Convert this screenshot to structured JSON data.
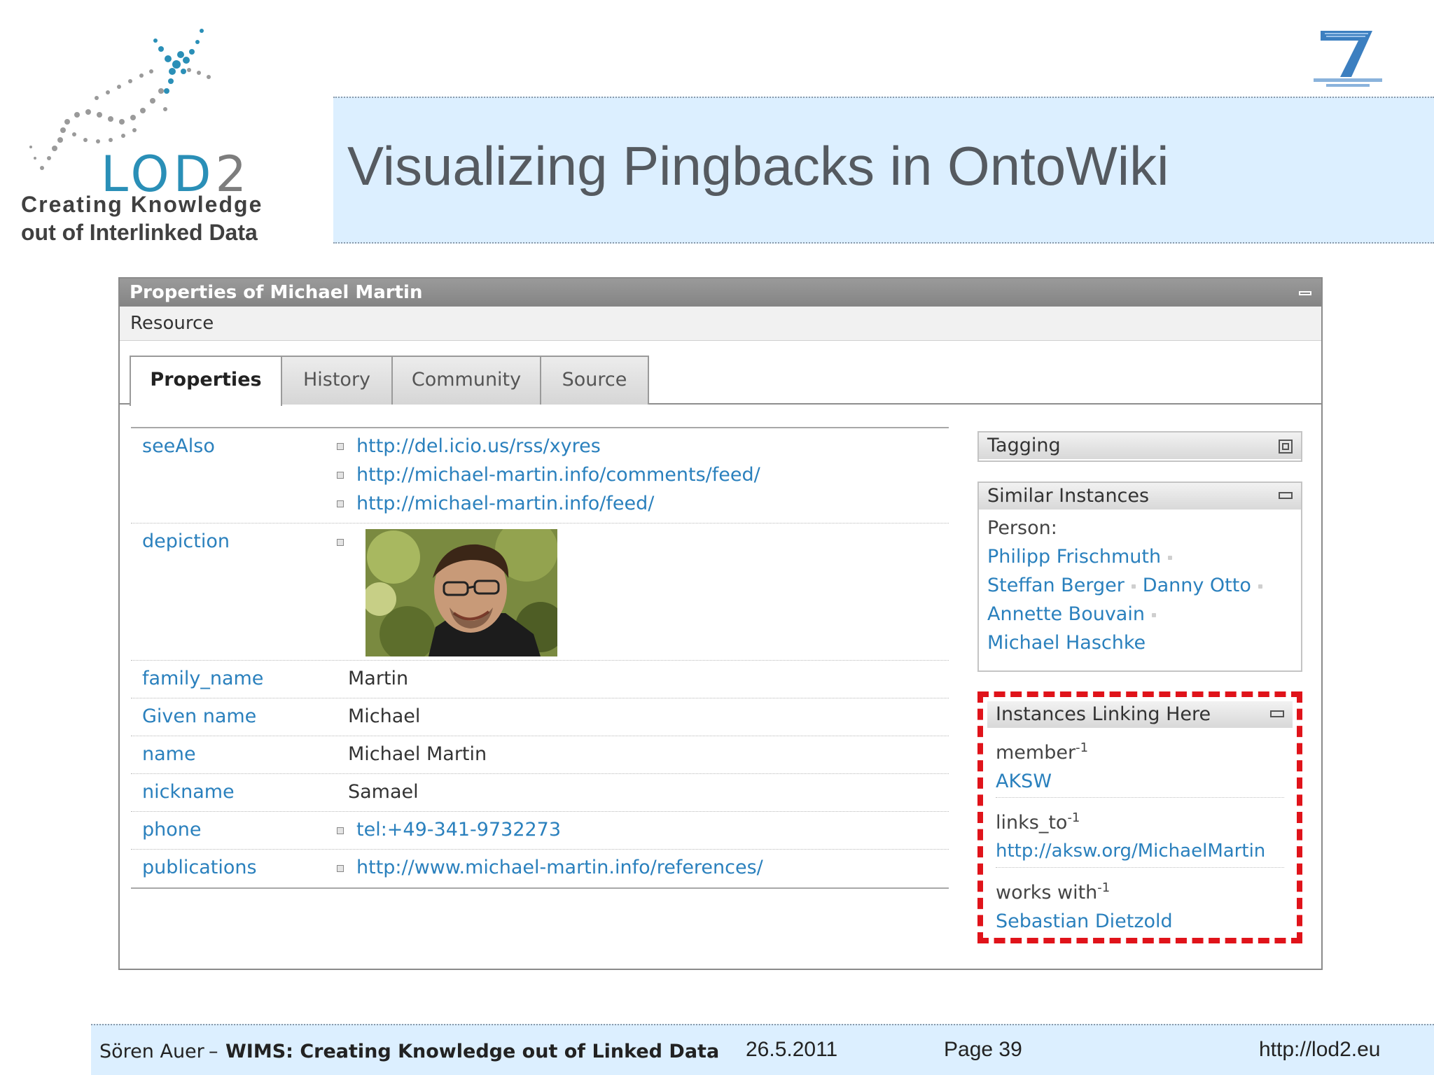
{
  "logo": {
    "word_main": "LOD",
    "word_num": "2",
    "tagline_1": "Creating Knowledge",
    "tagline_2": "out of Interlinked Data"
  },
  "slide": {
    "title": "Visualizing Pingbacks in OntoWiki"
  },
  "panel": {
    "title": "Properties of Michael Martin",
    "resource_label": "Resource",
    "tabs": [
      "Properties",
      "History",
      "Community",
      "Source"
    ],
    "active_tab": "Properties",
    "properties": {
      "seeAlso": {
        "key": "seeAlso",
        "values": [
          "http://del.icio.us/rss/xyres",
          "http://michael-martin.info/comments/feed/",
          "http://michael-martin.info/feed/"
        ]
      },
      "depiction": {
        "key": "depiction"
      },
      "family_name": {
        "key": "family_name",
        "value": "Martin"
      },
      "given_name": {
        "key": "Given name",
        "value": "Michael"
      },
      "name": {
        "key": "name",
        "value": "Michael Martin"
      },
      "nickname": {
        "key": "nickname",
        "value": "Samael"
      },
      "phone": {
        "key": "phone",
        "value": "tel:+49-341-9732273"
      },
      "publications": {
        "key": "publications",
        "value": "http://www.michael-martin.info/references/"
      }
    },
    "tagging": {
      "title": "Tagging"
    },
    "similar": {
      "title": "Similar Instances",
      "class_label": "Person:",
      "people": [
        "Philipp Frischmuth",
        "Steffan Berger",
        "Danny Otto",
        "Annette Bouvain",
        "Michael Haschke"
      ]
    },
    "linking": {
      "title": "Instances Linking Here",
      "sup": "-1",
      "sections": [
        {
          "relation": "member",
          "target": "AKSW"
        },
        {
          "relation": "links_to",
          "target": "http://aksw.org/MichaelMartin"
        },
        {
          "relation": "works with",
          "target": "Sebastian Dietzold"
        }
      ]
    }
  },
  "footer": {
    "author": "Sören Auer",
    "dash": "–",
    "talk": "WIMS: Creating Knowledge out of Linked Data",
    "date": "26.5.2011",
    "page": "Page 39",
    "url": "http://lod2.eu"
  },
  "colors": {
    "title_band": "#dcefff",
    "link": "#2a80bd",
    "highlight": "#e0131a",
    "logo_blue": "#2a8fb7"
  }
}
